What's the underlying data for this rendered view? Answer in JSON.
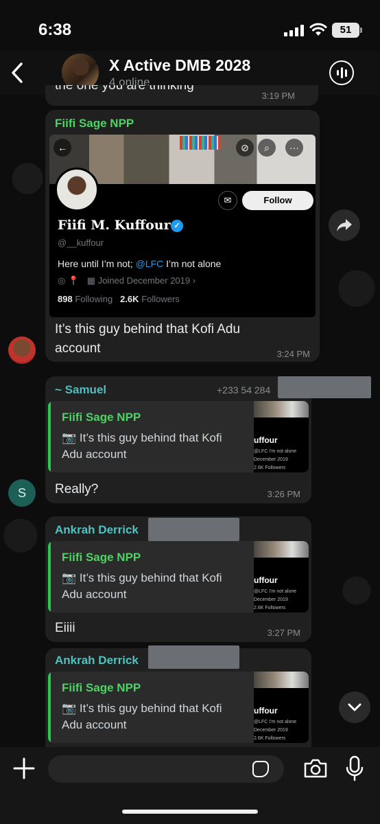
{
  "status_bar": {
    "time": "6:38",
    "battery": "51"
  },
  "header": {
    "title": "X Active DMB 2028",
    "subtitle": "4 online"
  },
  "previous_message": {
    "text": "the one you are thinking",
    "time": "3:19 PM"
  },
  "main_message": {
    "sender": "Fiifi Sage NPP",
    "sender_color": "#4fd266",
    "profile": {
      "name": "Fiifi M. Kuffour",
      "handle": "@__kuffour",
      "follow_label": "Follow",
      "bio_before": "Here until I’m not; ",
      "bio_link": "@LFC",
      "bio_after": " I’m not alone",
      "joined": "Joined December 2019",
      "following_count": "898",
      "following_label": "Following",
      "followers_count": "2.6K",
      "followers_label": "Followers"
    },
    "text": "It’s this guy behind that Kofi Adu account",
    "time": "3:24 PM"
  },
  "replies": [
    {
      "sender": "~ Samuel",
      "phone": "+233 54 284",
      "quote_name": "Fiifi Sage NPP",
      "quote_text": "It’s this guy behind that Kofi Adu account",
      "text": "Really?",
      "time": "3:26 PM",
      "avatar_letter": "S"
    },
    {
      "sender": "Ankrah Derrick",
      "quote_name": "Fiifi Sage NPP",
      "quote_text": "It’s this guy behind that Kofi Adu account",
      "text": "Eiiii",
      "time": "3:27 PM"
    },
    {
      "sender": "Ankrah Derrick",
      "quote_name": "Fiifi Sage NPP",
      "quote_text": "It’s this guy behind that Kofi Adu account"
    }
  ],
  "thumb": {
    "name": "uffour",
    "bio": "@LFC I'm not alone",
    "joined": "December 2019",
    "followers": "2.6K Followers"
  },
  "input": {
    "placeholder": ""
  },
  "colors": {
    "accent_green": "#29c84f",
    "link_blue": "#1d9bf0",
    "samuel_name": "#53bdbd",
    "derrick_name": "#4fc3c0"
  }
}
